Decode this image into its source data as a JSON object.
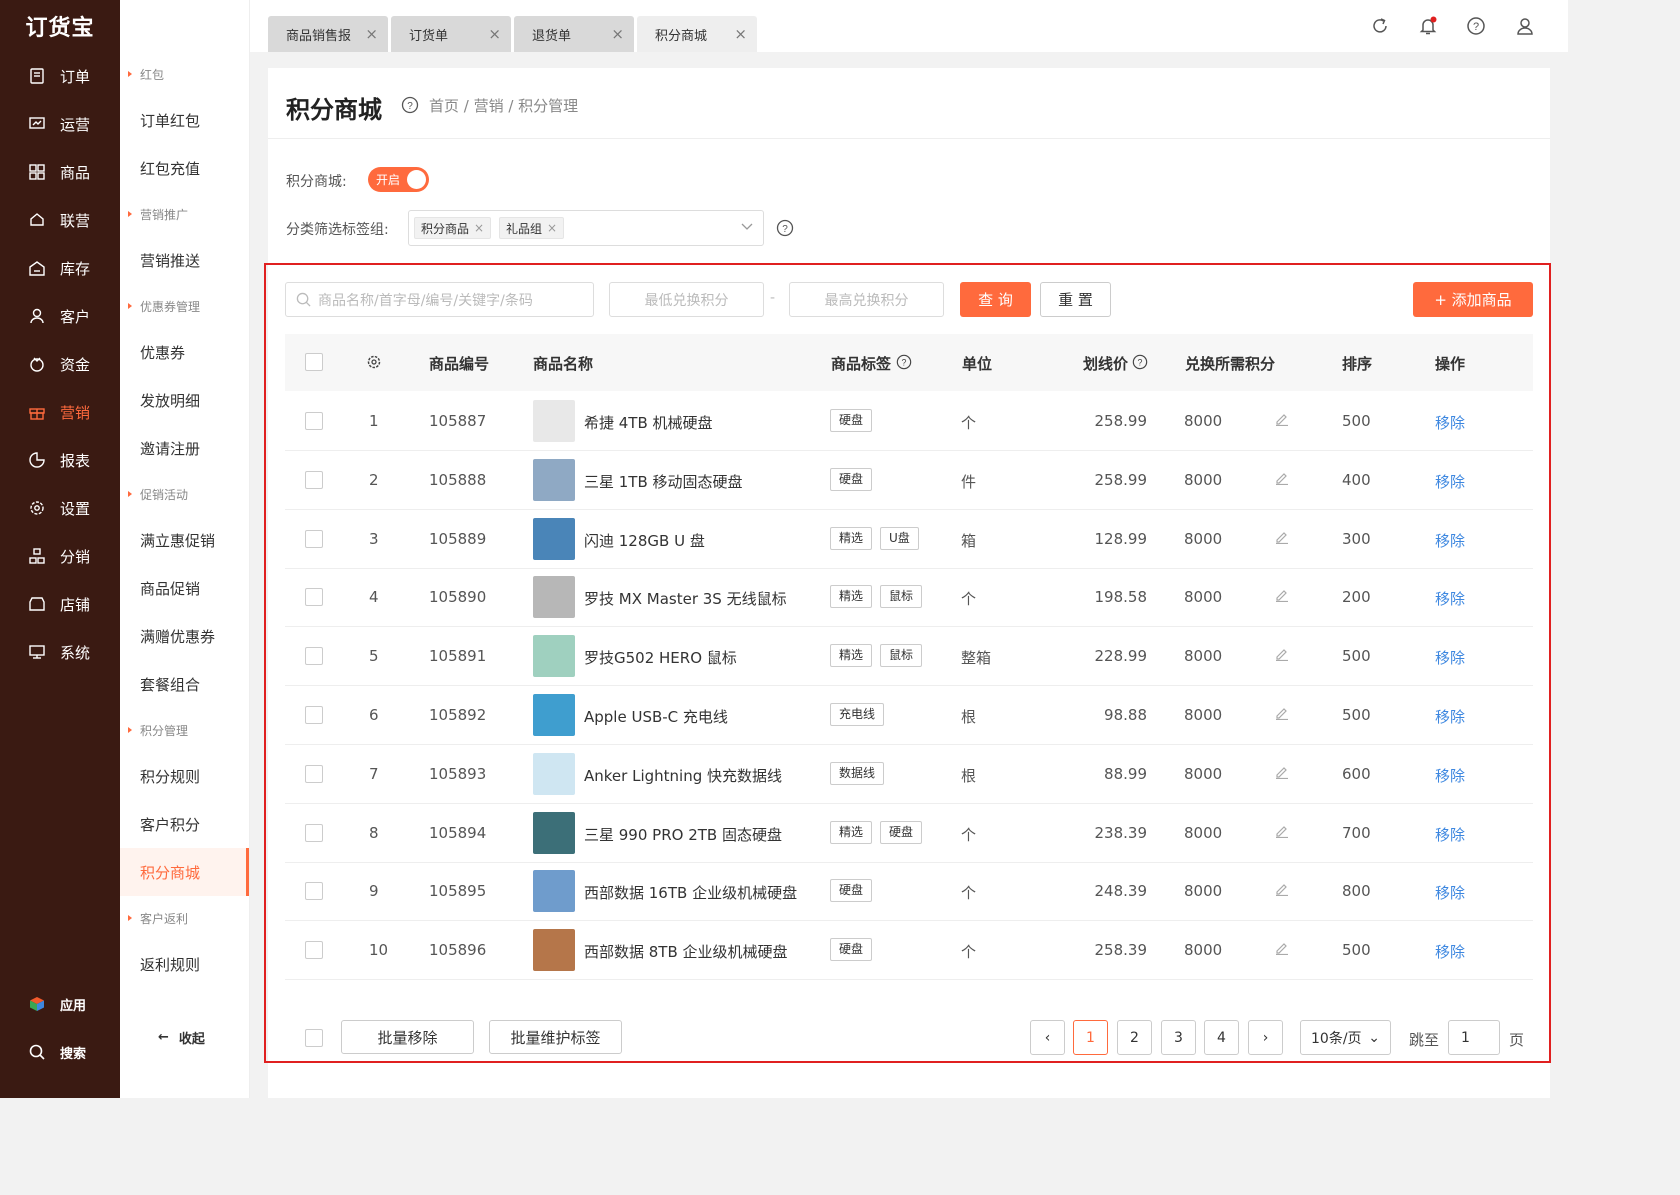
{
  "sidebar": {
    "logo": "订货宝",
    "items": [
      {
        "label": "订单",
        "icon": "order-icon"
      },
      {
        "label": "运营",
        "icon": "operation-icon"
      },
      {
        "label": "商品",
        "icon": "goods-icon"
      },
      {
        "label": "联营",
        "icon": "union-icon"
      },
      {
        "label": "库存",
        "icon": "stock-icon"
      },
      {
        "label": "客户",
        "icon": "customer-icon"
      },
      {
        "label": "资金",
        "icon": "money-icon"
      },
      {
        "label": "营销",
        "icon": "gift-icon",
        "active": true
      },
      {
        "label": "报表",
        "icon": "chart-icon"
      },
      {
        "label": "设置",
        "icon": "gear-icon"
      },
      {
        "label": "分销",
        "icon": "distribute-icon"
      },
      {
        "label": "店铺",
        "icon": "shop-icon"
      },
      {
        "label": "系统",
        "icon": "monitor-icon"
      }
    ],
    "apps_label": "应用",
    "search_label": "搜索"
  },
  "submenu": {
    "groups": [
      {
        "title": "红包",
        "items": [
          "订单红包",
          "红包充值"
        ]
      },
      {
        "title": "营销推广",
        "items": [
          "营销推送"
        ]
      },
      {
        "title": "优惠券管理",
        "items": [
          "优惠券",
          "发放明细",
          "邀请注册"
        ]
      },
      {
        "title": "促销活动",
        "items": [
          "满立惠促销",
          "商品促销",
          "满赠优惠券",
          "套餐组合"
        ]
      },
      {
        "title": "积分管理",
        "items": [
          "积分规则",
          "客户积分",
          "积分商城"
        ]
      },
      {
        "title": "客户返利",
        "items": [
          "返利规则"
        ]
      }
    ],
    "active": "积分商城",
    "collapse_label": "收起"
  },
  "tabs": [
    "商品销售报",
    "订货单",
    "退货单",
    "积分商城"
  ],
  "active_tab": "积分商城",
  "page": {
    "title": "积分商城",
    "breadcrumb": "首页 / 营销 / 积分管理",
    "mall_label": "积分商城:",
    "toggle_label": "开启",
    "tag_filter_label": "分类筛选标签组:",
    "selected_tags": [
      "积分商品",
      "礼品组"
    ]
  },
  "filters": {
    "search_placeholder": "商品名称/首字母/编号/关键字/条码",
    "min_placeholder": "最低兑换积分",
    "max_placeholder": "最高兑换积分",
    "dash": "-",
    "query_label": "查 询",
    "reset_label": "重 置",
    "add_label": "+ 添加商品"
  },
  "table": {
    "columns": [
      "商品编号",
      "商品名称",
      "商品标签",
      "单位",
      "划线价",
      "兑换所需积分",
      "排序",
      "操作"
    ],
    "rows": [
      {
        "index": "1",
        "code": "105887",
        "name": "希捷 4TB 机械硬盘",
        "tags": [
          "硬盘"
        ],
        "unit": "个",
        "price": "258.99",
        "points": "8000",
        "sort": "500",
        "action": "移除",
        "thumb": "#e8e8e8"
      },
      {
        "index": "2",
        "code": "105888",
        "name": "三星 1TB 移动固态硬盘",
        "tags": [
          "硬盘"
        ],
        "unit": "件",
        "price": "258.99",
        "points": "8000",
        "sort": "400",
        "action": "移除",
        "thumb": "#8fa9c4"
      },
      {
        "index": "3",
        "code": "105889",
        "name": "闪迪 128GB U 盘",
        "tags": [
          "精选",
          "U盘"
        ],
        "unit": "箱",
        "price": "128.99",
        "points": "8000",
        "sort": "300",
        "action": "移除",
        "thumb": "#4a85b8"
      },
      {
        "index": "4",
        "code": "105890",
        "name": "罗技 MX Master 3S 无线鼠标",
        "tags": [
          "精选",
          "鼠标"
        ],
        "unit": "个",
        "price": "198.58",
        "points": "8000",
        "sort": "200",
        "action": "移除",
        "thumb": "#b7b7b7"
      },
      {
        "index": "5",
        "code": "105891",
        "name": "罗技G502 HERO 鼠标",
        "tags": [
          "精选",
          "鼠标"
        ],
        "unit": "整箱",
        "price": "228.99",
        "points": "8000",
        "sort": "500",
        "action": "移除",
        "thumb": "#9fd0bf"
      },
      {
        "index": "6",
        "code": "105892",
        "name": "Apple USB-C 充电线",
        "tags": [
          "充电线"
        ],
        "unit": "根",
        "price": "98.88",
        "points": "8000",
        "sort": "500",
        "action": "移除",
        "thumb": "#3f9ecf"
      },
      {
        "index": "7",
        "code": "105893",
        "name": "Anker Lightning 快充数据线",
        "tags": [
          "数据线"
        ],
        "unit": "根",
        "price": "88.99",
        "points": "8000",
        "sort": "600",
        "action": "移除",
        "thumb": "#cfe6f2"
      },
      {
        "index": "8",
        "code": "105894",
        "name": "三星 990 PRO 2TB 固态硬盘",
        "tags": [
          "精选",
          "硬盘"
        ],
        "unit": "个",
        "price": "238.39",
        "points": "8000",
        "sort": "700",
        "action": "移除",
        "thumb": "#3c6f78"
      },
      {
        "index": "9",
        "code": "105895",
        "name": "西部数据 16TB 企业级机械硬盘",
        "tags": [
          "硬盘"
        ],
        "unit": "个",
        "price": "248.39",
        "points": "8000",
        "sort": "800",
        "action": "移除",
        "thumb": "#6f9ccc"
      },
      {
        "index": "10",
        "code": "105896",
        "name": "西部数据 8TB 企业级机械硬盘",
        "tags": [
          "硬盘"
        ],
        "unit": "个",
        "price": "258.39",
        "points": "8000",
        "sort": "500",
        "action": "移除",
        "thumb": "#b5764a"
      }
    ]
  },
  "footer": {
    "batch_remove": "批量移除",
    "batch_tags": "批量维护标签",
    "pages": [
      "1",
      "2",
      "3",
      "4"
    ],
    "current_page": "1",
    "page_size": "10条/页",
    "jump_label": "跳至",
    "jump_value": "1",
    "page_suffix": "页"
  },
  "colors": {
    "accent": "#ff6a3d",
    "sidebar": "#3a1a12",
    "link": "#3d87e0",
    "highlight": "#e02020"
  }
}
